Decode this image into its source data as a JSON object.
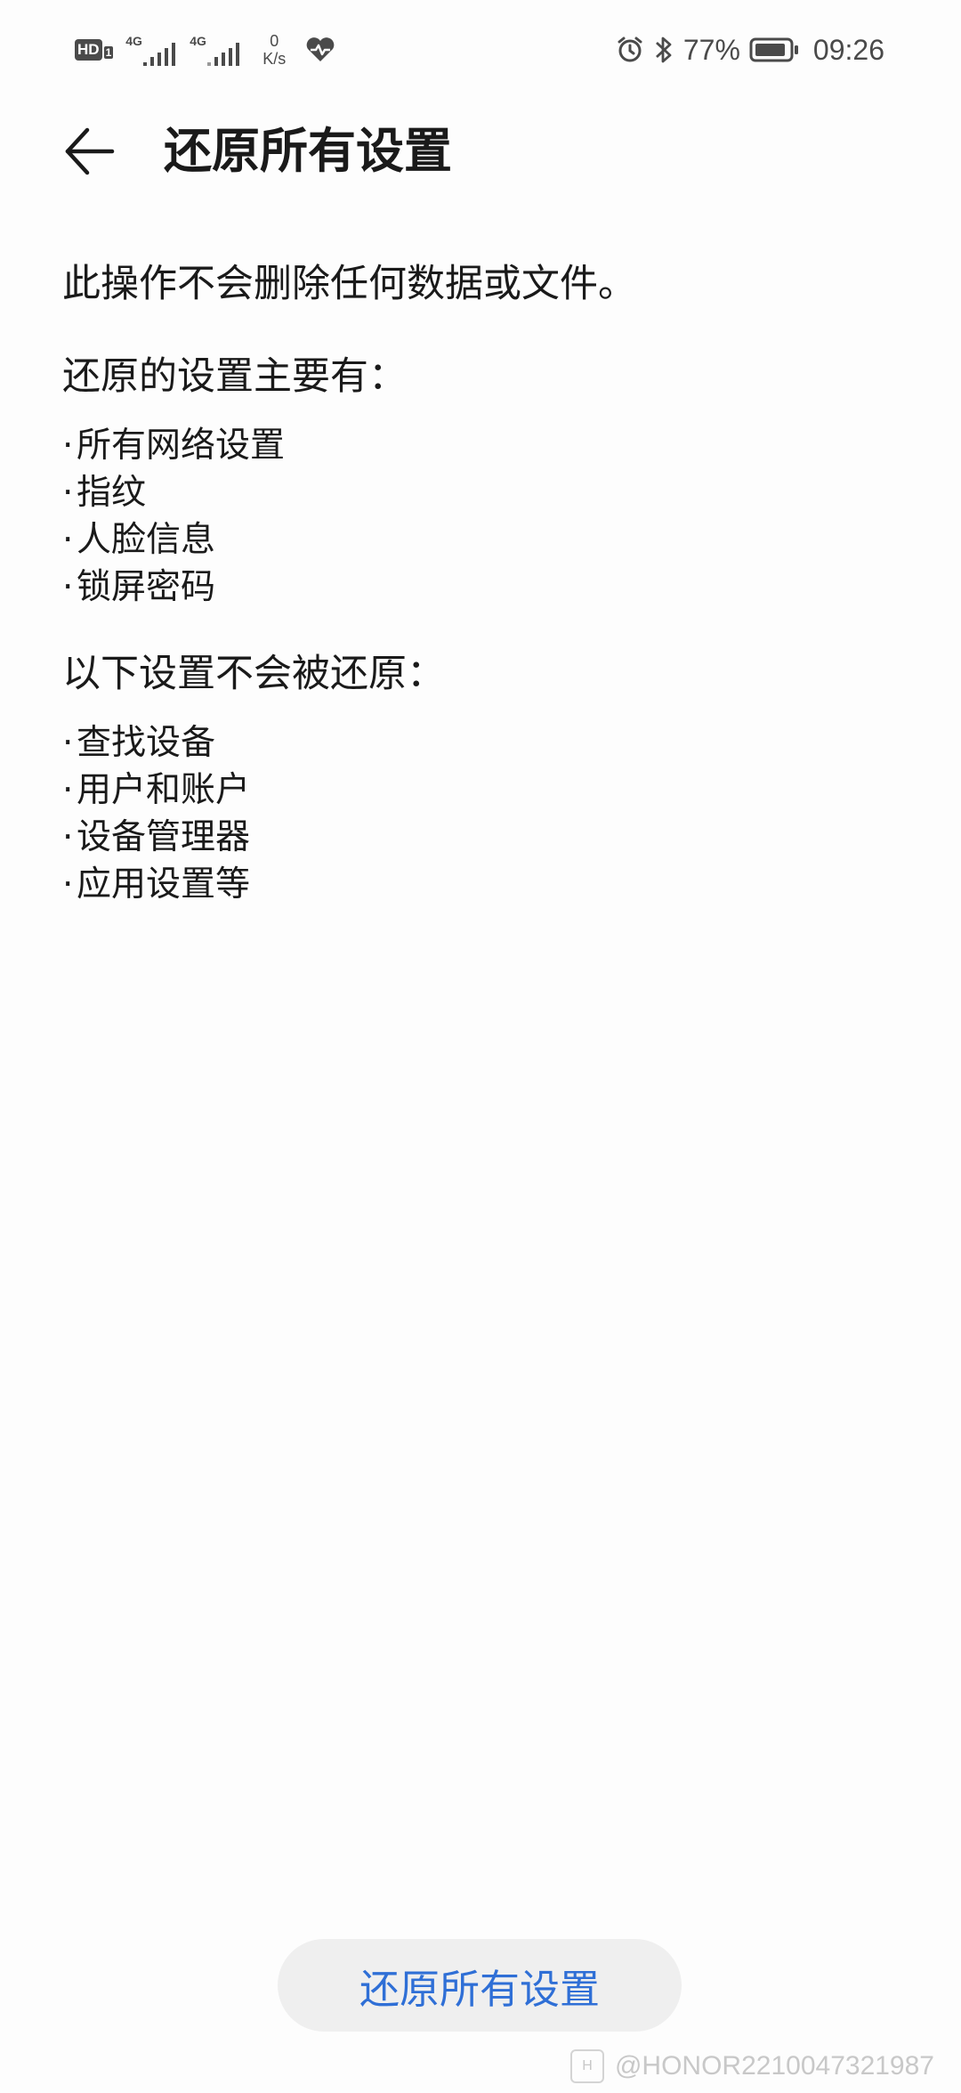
{
  "status_bar": {
    "hd_label": "HD",
    "hd_sim": "1",
    "signal1_label": "4G",
    "signal2_label": "4G",
    "net_speed_value": "0",
    "net_speed_unit": "K/s",
    "battery_percent": "77%",
    "time": "09:26",
    "icons": [
      "hd-icon",
      "signal-icon",
      "signal-icon",
      "heart-health-icon",
      "alarm-icon",
      "bluetooth-icon",
      "battery-icon"
    ]
  },
  "header": {
    "title": "还原所有设置"
  },
  "main": {
    "intro": "此操作不会删除任何数据或文件。",
    "reset_heading": "还原的设置主要有：",
    "reset_items": [
      "所有网络设置",
      "指纹",
      "人脸信息",
      "锁屏密码"
    ],
    "keep_heading": "以下设置不会被还原：",
    "keep_items": [
      "查找设备",
      "用户和账户",
      "设备管理器",
      "应用设置等"
    ]
  },
  "footer": {
    "reset_button_label": "还原所有设置"
  },
  "watermark": {
    "text": "@HONOR2210047321987"
  },
  "colors": {
    "accent": "#2f6fd6",
    "button_bg": "#efefef",
    "background": "#fdfdfd",
    "text": "#1a1a1a"
  }
}
